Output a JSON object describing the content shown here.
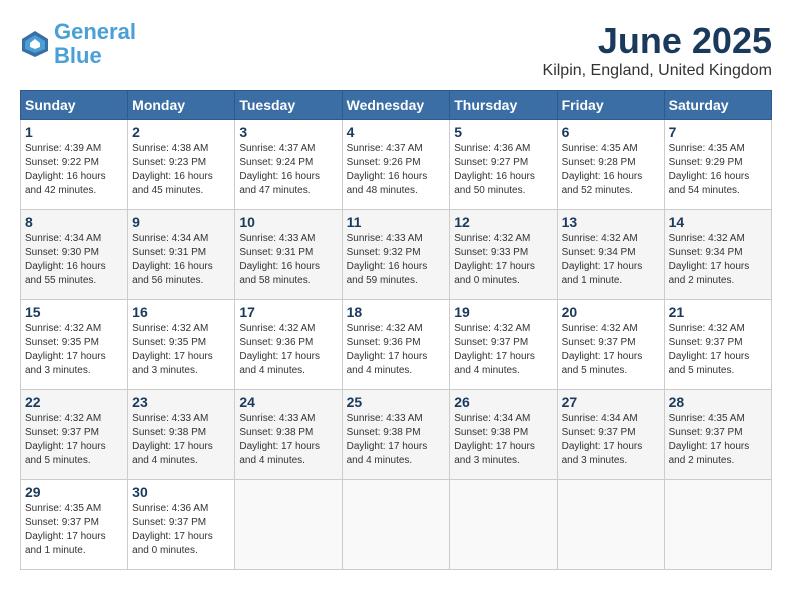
{
  "header": {
    "logo_line1": "General",
    "logo_line2": "Blue",
    "month": "June 2025",
    "location": "Kilpin, England, United Kingdom"
  },
  "weekdays": [
    "Sunday",
    "Monday",
    "Tuesday",
    "Wednesday",
    "Thursday",
    "Friday",
    "Saturday"
  ],
  "weeks": [
    [
      {
        "day": "1",
        "info": "Sunrise: 4:39 AM\nSunset: 9:22 PM\nDaylight: 16 hours\nand 42 minutes."
      },
      {
        "day": "2",
        "info": "Sunrise: 4:38 AM\nSunset: 9:23 PM\nDaylight: 16 hours\nand 45 minutes."
      },
      {
        "day": "3",
        "info": "Sunrise: 4:37 AM\nSunset: 9:24 PM\nDaylight: 16 hours\nand 47 minutes."
      },
      {
        "day": "4",
        "info": "Sunrise: 4:37 AM\nSunset: 9:26 PM\nDaylight: 16 hours\nand 48 minutes."
      },
      {
        "day": "5",
        "info": "Sunrise: 4:36 AM\nSunset: 9:27 PM\nDaylight: 16 hours\nand 50 minutes."
      },
      {
        "day": "6",
        "info": "Sunrise: 4:35 AM\nSunset: 9:28 PM\nDaylight: 16 hours\nand 52 minutes."
      },
      {
        "day": "7",
        "info": "Sunrise: 4:35 AM\nSunset: 9:29 PM\nDaylight: 16 hours\nand 54 minutes."
      }
    ],
    [
      {
        "day": "8",
        "info": "Sunrise: 4:34 AM\nSunset: 9:30 PM\nDaylight: 16 hours\nand 55 minutes."
      },
      {
        "day": "9",
        "info": "Sunrise: 4:34 AM\nSunset: 9:31 PM\nDaylight: 16 hours\nand 56 minutes."
      },
      {
        "day": "10",
        "info": "Sunrise: 4:33 AM\nSunset: 9:31 PM\nDaylight: 16 hours\nand 58 minutes."
      },
      {
        "day": "11",
        "info": "Sunrise: 4:33 AM\nSunset: 9:32 PM\nDaylight: 16 hours\nand 59 minutes."
      },
      {
        "day": "12",
        "info": "Sunrise: 4:32 AM\nSunset: 9:33 PM\nDaylight: 17 hours\nand 0 minutes."
      },
      {
        "day": "13",
        "info": "Sunrise: 4:32 AM\nSunset: 9:34 PM\nDaylight: 17 hours\nand 1 minute."
      },
      {
        "day": "14",
        "info": "Sunrise: 4:32 AM\nSunset: 9:34 PM\nDaylight: 17 hours\nand 2 minutes."
      }
    ],
    [
      {
        "day": "15",
        "info": "Sunrise: 4:32 AM\nSunset: 9:35 PM\nDaylight: 17 hours\nand 3 minutes."
      },
      {
        "day": "16",
        "info": "Sunrise: 4:32 AM\nSunset: 9:35 PM\nDaylight: 17 hours\nand 3 minutes."
      },
      {
        "day": "17",
        "info": "Sunrise: 4:32 AM\nSunset: 9:36 PM\nDaylight: 17 hours\nand 4 minutes."
      },
      {
        "day": "18",
        "info": "Sunrise: 4:32 AM\nSunset: 9:36 PM\nDaylight: 17 hours\nand 4 minutes."
      },
      {
        "day": "19",
        "info": "Sunrise: 4:32 AM\nSunset: 9:37 PM\nDaylight: 17 hours\nand 4 minutes."
      },
      {
        "day": "20",
        "info": "Sunrise: 4:32 AM\nSunset: 9:37 PM\nDaylight: 17 hours\nand 5 minutes."
      },
      {
        "day": "21",
        "info": "Sunrise: 4:32 AM\nSunset: 9:37 PM\nDaylight: 17 hours\nand 5 minutes."
      }
    ],
    [
      {
        "day": "22",
        "info": "Sunrise: 4:32 AM\nSunset: 9:37 PM\nDaylight: 17 hours\nand 5 minutes."
      },
      {
        "day": "23",
        "info": "Sunrise: 4:33 AM\nSunset: 9:38 PM\nDaylight: 17 hours\nand 4 minutes."
      },
      {
        "day": "24",
        "info": "Sunrise: 4:33 AM\nSunset: 9:38 PM\nDaylight: 17 hours\nand 4 minutes."
      },
      {
        "day": "25",
        "info": "Sunrise: 4:33 AM\nSunset: 9:38 PM\nDaylight: 17 hours\nand 4 minutes."
      },
      {
        "day": "26",
        "info": "Sunrise: 4:34 AM\nSunset: 9:38 PM\nDaylight: 17 hours\nand 3 minutes."
      },
      {
        "day": "27",
        "info": "Sunrise: 4:34 AM\nSunset: 9:37 PM\nDaylight: 17 hours\nand 3 minutes."
      },
      {
        "day": "28",
        "info": "Sunrise: 4:35 AM\nSunset: 9:37 PM\nDaylight: 17 hours\nand 2 minutes."
      }
    ],
    [
      {
        "day": "29",
        "info": "Sunrise: 4:35 AM\nSunset: 9:37 PM\nDaylight: 17 hours\nand 1 minute."
      },
      {
        "day": "30",
        "info": "Sunrise: 4:36 AM\nSunset: 9:37 PM\nDaylight: 17 hours\nand 0 minutes."
      },
      {
        "day": "",
        "info": ""
      },
      {
        "day": "",
        "info": ""
      },
      {
        "day": "",
        "info": ""
      },
      {
        "day": "",
        "info": ""
      },
      {
        "day": "",
        "info": ""
      }
    ]
  ]
}
